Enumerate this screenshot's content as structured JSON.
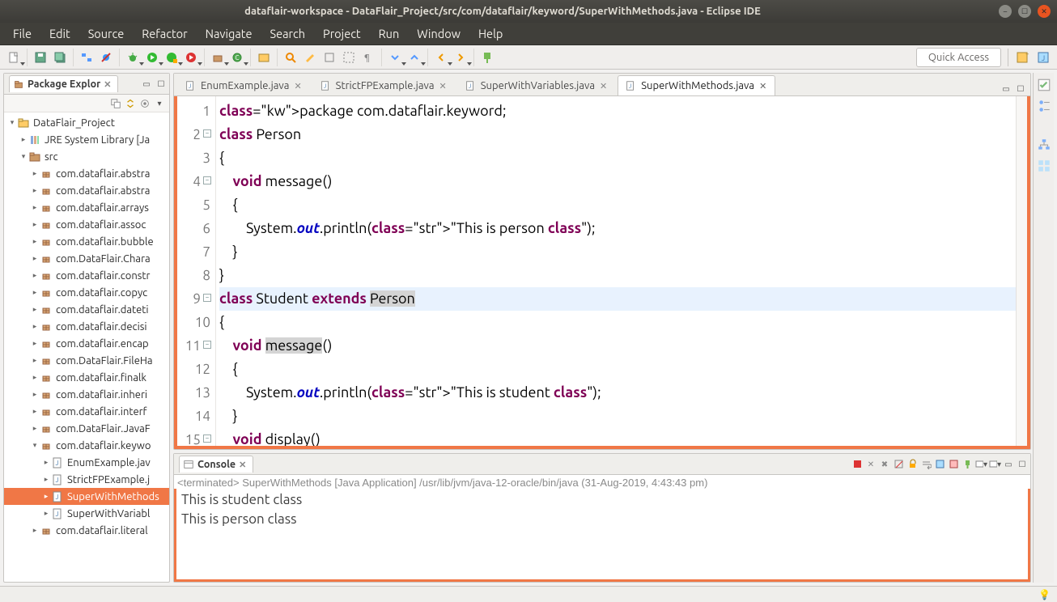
{
  "window": {
    "title": "dataflair-workspace - DataFlair_Project/src/com/dataflair/keyword/SuperWithMethods.java - Eclipse IDE"
  },
  "menu": [
    "File",
    "Edit",
    "Source",
    "Refactor",
    "Navigate",
    "Search",
    "Project",
    "Run",
    "Window",
    "Help"
  ],
  "quick_access": "Quick Access",
  "explorer": {
    "title": "Package Explor",
    "project": "DataFlair_Project",
    "jre": "JRE System Library [Ja",
    "src": "src",
    "packages": [
      "com.dataflair.abstra",
      "com.dataflair.abstra",
      "com.dataflair.arrays",
      "com.dataflair.assoc",
      "com.dataflair.bubble",
      "com.DataFlair.Chara",
      "com.dataflair.constr",
      "com.dataflair.copyc",
      "com.dataflair.dateti",
      "com.dataflair.decisi",
      "com.dataflair.encap",
      "com.DataFlair.FileHa",
      "com.dataflair.finalk",
      "com.dataflair.inheri",
      "com.dataflair.interf",
      "com.DataFlair.JavaF"
    ],
    "open_pkg": "com.dataflair.keywo",
    "files": [
      "EnumExample.jav",
      "StrictFPExample.j",
      "SuperWithMethods",
      "SuperWithVariabl"
    ],
    "selected_file_index": 2,
    "tail_pkg": "com.dataflair.literal"
  },
  "editor": {
    "tabs": [
      "EnumExample.java",
      "StrictFPExample.java",
      "SuperWithVariables.java",
      "SuperWithMethods.java"
    ],
    "active_tab": 3,
    "code_lines": [
      {
        "n": 1,
        "raw": "package com.dataflair.keyword;"
      },
      {
        "n": 2,
        "raw": "class Person"
      },
      {
        "n": 3,
        "raw": "{"
      },
      {
        "n": 4,
        "raw": "    void message()"
      },
      {
        "n": 5,
        "raw": "    {"
      },
      {
        "n": 6,
        "raw": "        System.out.println(\"This is person class\");"
      },
      {
        "n": 7,
        "raw": "    }"
      },
      {
        "n": 8,
        "raw": "}"
      },
      {
        "n": 9,
        "raw": "class Student extends Person"
      },
      {
        "n": 10,
        "raw": "{"
      },
      {
        "n": 11,
        "raw": "    void message()"
      },
      {
        "n": 12,
        "raw": "    {"
      },
      {
        "n": 13,
        "raw": "        System.out.println(\"This is student class\");"
      },
      {
        "n": 14,
        "raw": "    }"
      },
      {
        "n": 15,
        "raw": "    void display()"
      }
    ]
  },
  "console": {
    "title": "Console",
    "terminated": "<terminated> SuperWithMethods [Java Application] /usr/lib/jvm/java-12-oracle/bin/java (31-Aug-2019, 4:43:43 pm)",
    "output": [
      "This is student class",
      "This is person class"
    ]
  }
}
